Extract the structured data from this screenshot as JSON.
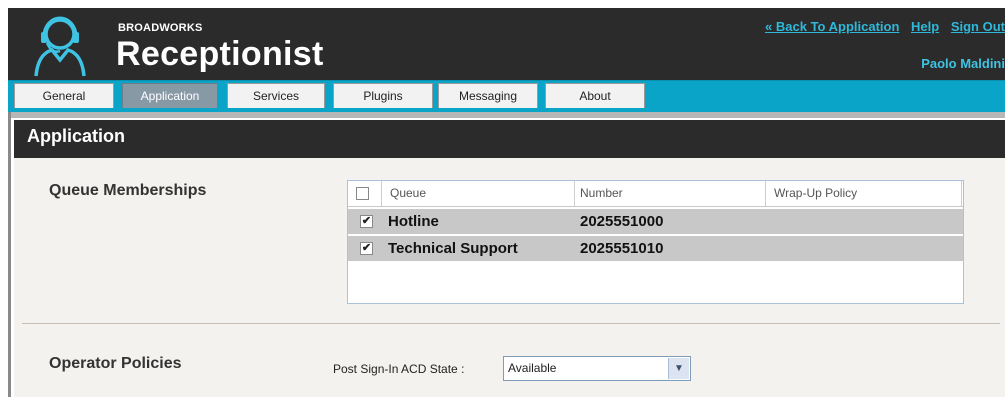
{
  "header": {
    "brand_small": "BROADWORKS",
    "brand_big": "Receptionist",
    "links": {
      "back": "« Back To Application",
      "help": "Help",
      "signout": "Sign Out"
    },
    "user_name": "Paolo Maldini"
  },
  "tabs": [
    {
      "label": "General",
      "active": false
    },
    {
      "label": "Application",
      "active": true
    },
    {
      "label": "Services",
      "active": false
    },
    {
      "label": "Plugins",
      "active": false
    },
    {
      "label": "Messaging",
      "active": false
    },
    {
      "label": "About",
      "active": false
    }
  ],
  "section": {
    "title": "Application"
  },
  "queue_memberships": {
    "label": "Queue Memberships",
    "columns": [
      "Queue",
      "Number",
      "Wrap-Up Policy"
    ],
    "select_all_checked": false,
    "rows": [
      {
        "queue": "Hotline",
        "number": "2025551000",
        "wrap_up": "",
        "checked": true
      },
      {
        "queue": "Technical Support",
        "number": "2025551010",
        "wrap_up": "",
        "checked": true
      }
    ]
  },
  "operator_policies": {
    "label": "Operator Policies",
    "post_signin_label": "Post Sign-In ACD State :",
    "post_signin_value": "Available"
  },
  "colors": {
    "header_bg": "#2b2b2b",
    "tabbar_bg": "#0aa4c8",
    "link": "#2fb8d9",
    "active_tab": "#8899a6",
    "row_bg": "#c8c8c8"
  },
  "icons": {
    "logo": "headset-person-icon",
    "checkbox": "checkmark-icon",
    "dropdown": "chevron-down-icon"
  }
}
